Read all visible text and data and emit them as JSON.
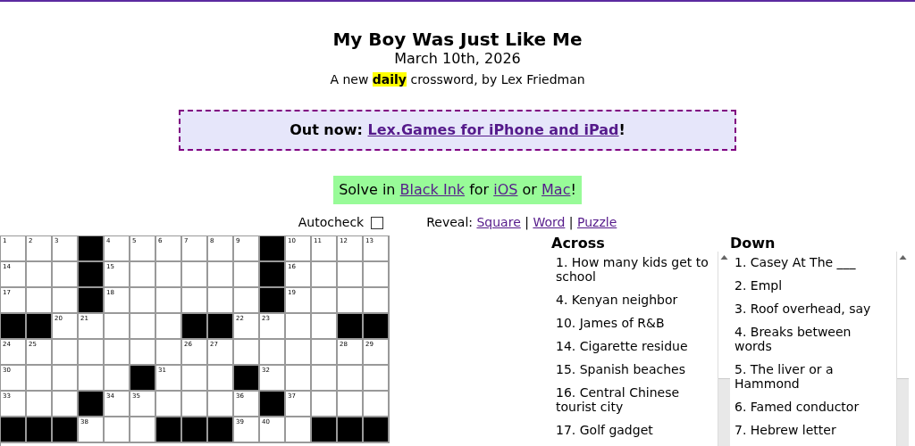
{
  "title": "My Boy Was Just Like Me",
  "date": "March 10th, 2026",
  "subtitle": "A new **daily** crossword, by Lex Friedman",
  "banner": {
    "prefix": "Out now:",
    "link": "Lex.Games for iPhone and iPad",
    "suffix": "!"
  },
  "solve_in": [
    {
      "kind": "text",
      "text": "Solve in"
    },
    {
      "kind": "link",
      "text": "Black Ink"
    },
    {
      "kind": "text",
      "text": "for"
    },
    {
      "kind": "link",
      "text": "iOS"
    },
    {
      "kind": "text",
      "text": "or"
    },
    {
      "kind": "link",
      "text": "Mac"
    },
    {
      "kind": "text",
      "text": "!"
    }
  ],
  "autocheck": {
    "label": "Autocheck",
    "checked": false
  },
  "reveal": [
    {
      "kind": "text",
      "text": "Reveal:"
    },
    {
      "kind": "link",
      "text": "Square"
    },
    {
      "kind": "text",
      "text": "|"
    },
    {
      "kind": "link",
      "text": "Word"
    },
    {
      "kind": "text",
      "text": "|"
    },
    {
      "kind": "link",
      "text": "Puzzle"
    }
  ],
  "grid": [
    [
      {
        "kind": "open",
        "number": "1"
      },
      {
        "kind": "open",
        "number": "2"
      },
      {
        "kind": "open",
        "number": "3"
      },
      {
        "kind": "block"
      },
      {
        "kind": "open",
        "number": "4"
      },
      {
        "kind": "open",
        "number": "5"
      },
      {
        "kind": "open",
        "number": "6"
      },
      {
        "kind": "open",
        "number": "7"
      },
      {
        "kind": "open",
        "number": "8"
      },
      {
        "kind": "open",
        "number": "9"
      },
      {
        "kind": "block"
      },
      {
        "kind": "open",
        "number": "10"
      },
      {
        "kind": "open",
        "number": "11"
      },
      {
        "kind": "open",
        "number": "12"
      },
      {
        "kind": "open",
        "number": "13"
      }
    ],
    [
      {
        "kind": "open",
        "number": "14"
      },
      {
        "kind": "open"
      },
      {
        "kind": "open"
      },
      {
        "kind": "block"
      },
      {
        "kind": "open",
        "number": "15"
      },
      {
        "kind": "open"
      },
      {
        "kind": "open"
      },
      {
        "kind": "open"
      },
      {
        "kind": "open"
      },
      {
        "kind": "open"
      },
      {
        "kind": "block"
      },
      {
        "kind": "open",
        "number": "16"
      },
      {
        "kind": "open"
      },
      {
        "kind": "open"
      },
      {
        "kind": "open"
      }
    ],
    [
      {
        "kind": "open",
        "number": "17"
      },
      {
        "kind": "open"
      },
      {
        "kind": "open"
      },
      {
        "kind": "block"
      },
      {
        "kind": "open",
        "number": "18"
      },
      {
        "kind": "open"
      },
      {
        "kind": "open"
      },
      {
        "kind": "open"
      },
      {
        "kind": "open"
      },
      {
        "kind": "open"
      },
      {
        "kind": "block"
      },
      {
        "kind": "open",
        "number": "19"
      },
      {
        "kind": "open"
      },
      {
        "kind": "open"
      },
      {
        "kind": "open"
      }
    ],
    [
      {
        "kind": "block"
      },
      {
        "kind": "block"
      },
      {
        "kind": "open",
        "number": "20"
      },
      {
        "kind": "open",
        "number": "21"
      },
      {
        "kind": "open"
      },
      {
        "kind": "open"
      },
      {
        "kind": "open"
      },
      {
        "kind": "block"
      },
      {
        "kind": "block"
      },
      {
        "kind": "open",
        "number": "22"
      },
      {
        "kind": "open",
        "number": "23"
      },
      {
        "kind": "open"
      },
      {
        "kind": "open"
      },
      {
        "kind": "block"
      },
      {
        "kind": "block"
      }
    ],
    [
      {
        "kind": "open",
        "number": "24"
      },
      {
        "kind": "open",
        "number": "25"
      },
      {
        "kind": "open"
      },
      {
        "kind": "open"
      },
      {
        "kind": "open"
      },
      {
        "kind": "open"
      },
      {
        "kind": "open"
      },
      {
        "kind": "open",
        "number": "26"
      },
      {
        "kind": "open",
        "number": "27"
      },
      {
        "kind": "open"
      },
      {
        "kind": "open"
      },
      {
        "kind": "open"
      },
      {
        "kind": "open"
      },
      {
        "kind": "open",
        "number": "28"
      },
      {
        "kind": "open",
        "number": "29"
      }
    ],
    [
      {
        "kind": "open",
        "number": "30"
      },
      {
        "kind": "open"
      },
      {
        "kind": "open"
      },
      {
        "kind": "open"
      },
      {
        "kind": "open"
      },
      {
        "kind": "block"
      },
      {
        "kind": "open",
        "number": "31"
      },
      {
        "kind": "open"
      },
      {
        "kind": "open"
      },
      {
        "kind": "block"
      },
      {
        "kind": "open",
        "number": "32"
      },
      {
        "kind": "open"
      },
      {
        "kind": "open"
      },
      {
        "kind": "open"
      },
      {
        "kind": "open"
      }
    ],
    [
      {
        "kind": "open",
        "number": "33"
      },
      {
        "kind": "open"
      },
      {
        "kind": "open"
      },
      {
        "kind": "block"
      },
      {
        "kind": "open",
        "number": "34"
      },
      {
        "kind": "open",
        "number": "35"
      },
      {
        "kind": "open"
      },
      {
        "kind": "open"
      },
      {
        "kind": "open"
      },
      {
        "kind": "open",
        "number": "36"
      },
      {
        "kind": "block"
      },
      {
        "kind": "open",
        "number": "37"
      },
      {
        "kind": "open"
      },
      {
        "kind": "open"
      },
      {
        "kind": "open"
      }
    ],
    [
      {
        "kind": "block"
      },
      {
        "kind": "block"
      },
      {
        "kind": "block"
      },
      {
        "kind": "open",
        "number": "38"
      },
      {
        "kind": "open"
      },
      {
        "kind": "open"
      },
      {
        "kind": "block"
      },
      {
        "kind": "block"
      },
      {
        "kind": "block"
      },
      {
        "kind": "open",
        "number": "39"
      },
      {
        "kind": "open",
        "number": "40"
      },
      {
        "kind": "open"
      },
      {
        "kind": "block"
      },
      {
        "kind": "block"
      },
      {
        "kind": "block"
      }
    ]
  ],
  "clues": [
    {
      "heading": "Across",
      "items": [
        "1. How many kids get to school",
        "4. Kenyan neighbor",
        "10. James of R&B",
        "14. Cigarette residue",
        "15. Spanish beaches",
        "16. Central Chinese tourist city",
        "17. Golf gadget"
      ]
    },
    {
      "heading": "Down",
      "items": [
        "1. Casey At The ___",
        "2. Empl",
        "3. Roof overhead, say",
        "4. Breaks between words",
        "5. The liver or a Hammond",
        "6. Famed conductor",
        "7. Hebrew letter"
      ]
    }
  ]
}
